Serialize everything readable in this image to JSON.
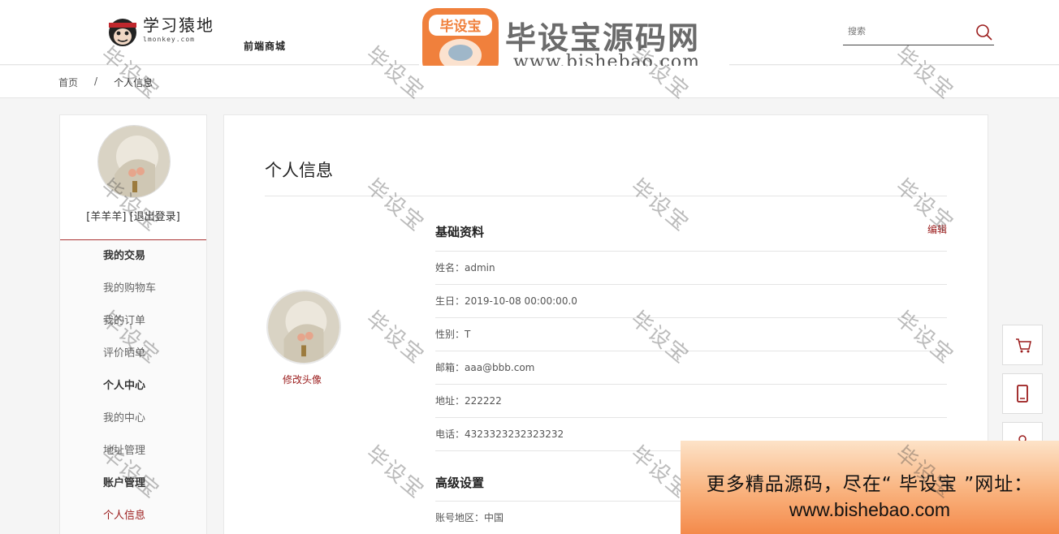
{
  "header": {
    "logo_cn": "学习猿地",
    "logo_en": "lmonkey.com",
    "logo_sub": "前端商城",
    "brand_title": "毕设宝源码网",
    "brand_badge": "毕设宝",
    "brand_url": "www.bishebao.com",
    "search_placeholder": "搜索"
  },
  "breadcrumb": {
    "home": "首页",
    "sep": "/",
    "current": "个人信息"
  },
  "sidebar": {
    "username": "[羊羊羊]",
    "logout": "[退出登录]",
    "groups": [
      {
        "title": "我的交易",
        "items": [
          "我的购物车",
          "我的订单",
          "评价晒单"
        ]
      },
      {
        "title": "个人中心",
        "items": [
          "我的中心",
          "地址管理"
        ]
      },
      {
        "title": "账户管理",
        "items": [
          "个人信息"
        ]
      }
    ]
  },
  "main": {
    "title": "个人信息",
    "change_avatar": "修改头像",
    "basic": {
      "title": "基础资料",
      "edit": "编辑",
      "rows": [
        "姓名：admin",
        "生日：2019-10-08 00:00:00.0",
        "性别：T",
        "邮箱：aaa@bbb.com",
        "地址：222222",
        "电话：4323323232323232"
      ]
    },
    "advanced": {
      "title": "高级设置",
      "rows": [
        "账号地区：中国"
      ]
    }
  },
  "watermark": "毕设宝",
  "promo": {
    "line1": "更多精品源码，尽在“ 毕设宝 ”网址：",
    "line2": "www.bishebao.com"
  },
  "colors": {
    "accent": "#9b1c1c",
    "brand_orange": "#f0803c"
  }
}
